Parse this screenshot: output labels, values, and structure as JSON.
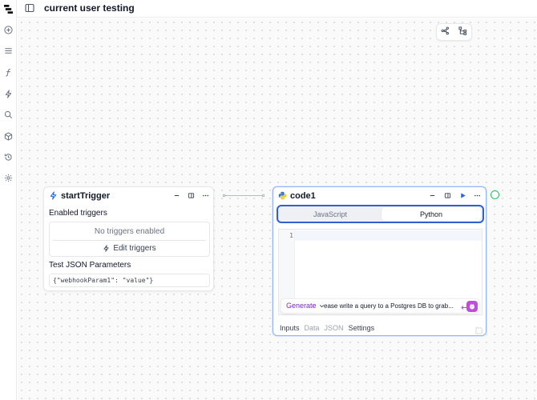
{
  "app": {
    "title": "current user testing"
  },
  "sidebar": {
    "items": [
      {
        "icon": "plus-circle-icon"
      },
      {
        "icon": "menu-icon"
      },
      {
        "icon": "function-icon"
      },
      {
        "icon": "bolt-icon"
      },
      {
        "icon": "search-icon"
      },
      {
        "icon": "package-icon"
      },
      {
        "icon": "history-icon"
      },
      {
        "icon": "gear-icon"
      }
    ]
  },
  "toolbar": {
    "icons": [
      "graph-layout-icon",
      "tree-layout-icon"
    ]
  },
  "trigger_node": {
    "title": "startTrigger",
    "enabled_label": "Enabled triggers",
    "no_triggers": "No triggers enabled",
    "edit_label": "Edit triggers",
    "params_label": "Test JSON Parameters",
    "params_value": "{\"webhookParam1\": \"value\"}"
  },
  "code_node": {
    "title": "code1",
    "tabs": {
      "javascript": "JavaScript",
      "python": "Python",
      "selected": "Python"
    },
    "line_number": "1",
    "generate_label": "Generate",
    "prompt_value": "ease write a query to a Postgres DB to grab...|",
    "bottom_tabs": [
      "Inputs",
      "Data",
      "JSON",
      "Settings"
    ],
    "active_bottom_tab": "Inputs"
  },
  "colors": {
    "accent": "#2e5fd4",
    "run": "#2563eb",
    "ai_purple": "#7e22ce",
    "status_ok": "#22c55e"
  }
}
